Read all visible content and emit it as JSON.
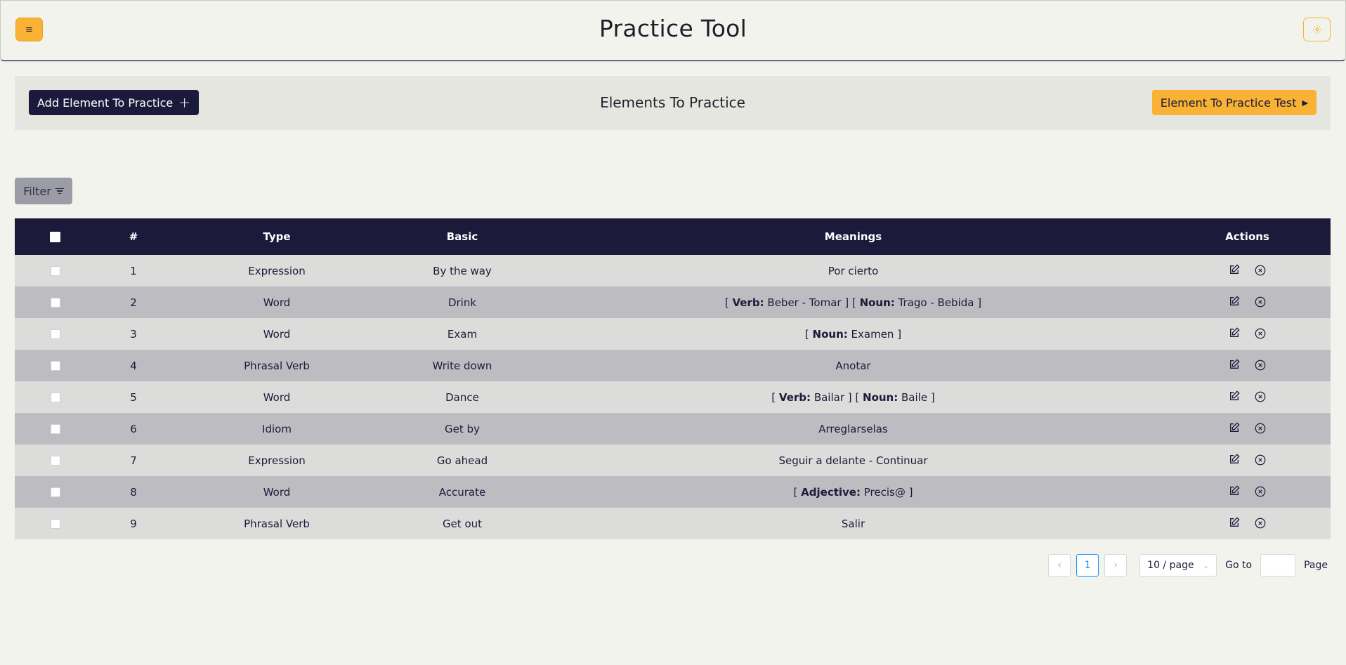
{
  "header": {
    "title": "Practice Tool",
    "menu_icon": "hamburger-icon",
    "settings_icon": "gear-icon",
    "accent": "#f9b233",
    "dark": "#1c1a3b"
  },
  "toolbar": {
    "add_label": "Add Element To Practice",
    "add_icon": "+",
    "title": "Elements To Practice",
    "test_label": "Element To Practice Test",
    "test_icon": "▶"
  },
  "filter": {
    "label": "Filter"
  },
  "table": {
    "headers": {
      "num": "#",
      "type": "Type",
      "basic": "Basic",
      "meanings": "Meanings",
      "actions": "Actions"
    },
    "rows": [
      {
        "num": "1",
        "type": "Expression",
        "basic": "By the way",
        "meanings": [
          {
            "text": "Por cierto"
          }
        ]
      },
      {
        "num": "2",
        "type": "Word",
        "basic": "Drink",
        "meanings": [
          {
            "pos": "Verb:",
            "text": "Beber - Tomar"
          },
          {
            "pos": "Noun:",
            "text": "Trago - Bebida"
          }
        ]
      },
      {
        "num": "3",
        "type": "Word",
        "basic": "Exam",
        "meanings": [
          {
            "pos": "Noun:",
            "text": "Examen"
          }
        ]
      },
      {
        "num": "4",
        "type": "Phrasal Verb",
        "basic": "Write down",
        "meanings": [
          {
            "text": "Anotar"
          }
        ]
      },
      {
        "num": "5",
        "type": "Word",
        "basic": "Dance",
        "meanings": [
          {
            "pos": "Verb:",
            "text": "Bailar"
          },
          {
            "pos": "Noun:",
            "text": "Baile"
          }
        ]
      },
      {
        "num": "6",
        "type": "Idiom",
        "basic": "Get by",
        "meanings": [
          {
            "text": "Arreglarselas"
          }
        ]
      },
      {
        "num": "7",
        "type": "Expression",
        "basic": "Go ahead",
        "meanings": [
          {
            "text": "Seguir a delante - Continuar"
          }
        ]
      },
      {
        "num": "8",
        "type": "Word",
        "basic": "Accurate",
        "meanings": [
          {
            "pos": "Adjective:",
            "text": "Precis@"
          }
        ]
      },
      {
        "num": "9",
        "type": "Phrasal Verb",
        "basic": "Get out",
        "meanings": [
          {
            "text": "Salir"
          }
        ]
      }
    ]
  },
  "pagination": {
    "prev_icon": "‹",
    "current_page": "1",
    "next_icon": "›",
    "page_size": "10 / page",
    "goto_label": "Go to",
    "goto_value": "",
    "page_label": "Page"
  }
}
